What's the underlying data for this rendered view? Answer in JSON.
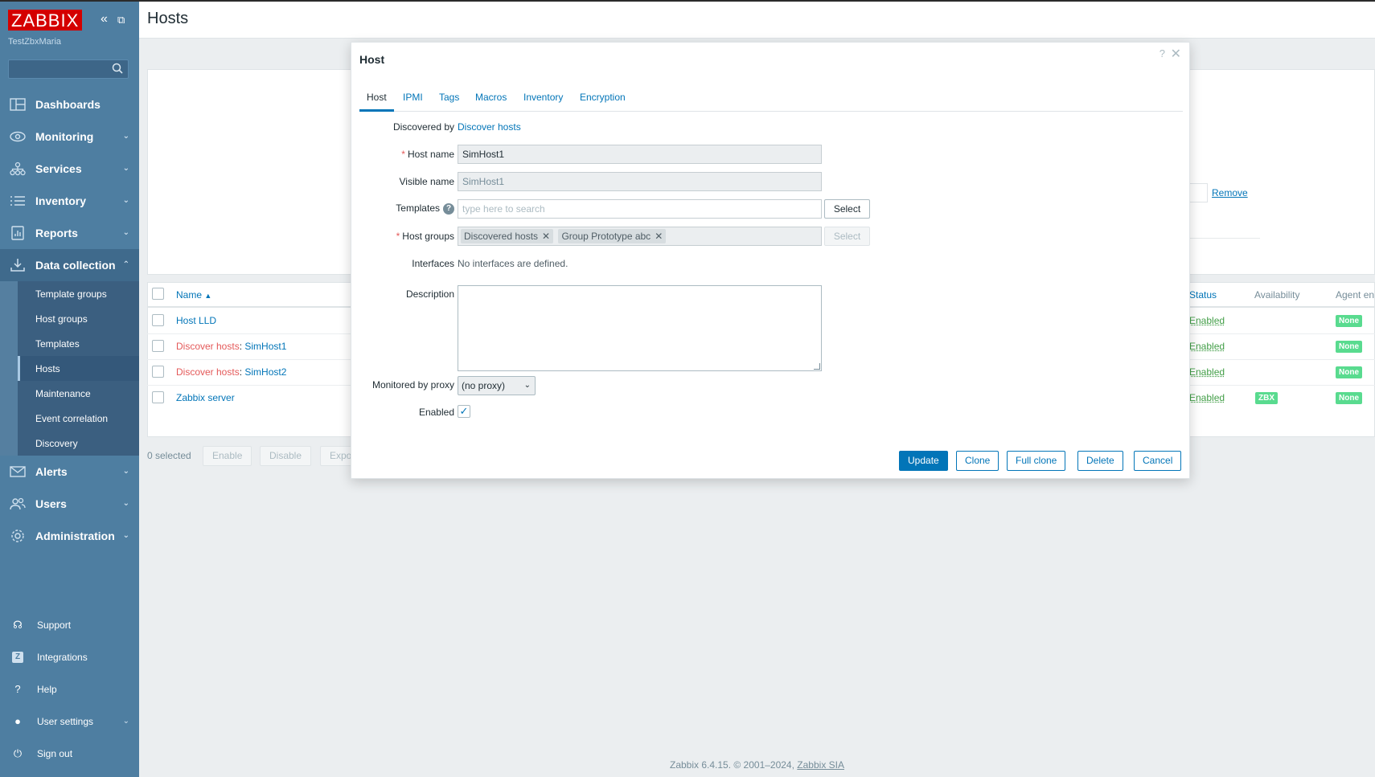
{
  "sidebar": {
    "logo": "ZABBIX",
    "org_name": "TestZbxMaria",
    "search_placeholder": "",
    "nav": [
      {
        "label": "Dashboards",
        "icon": "dashboards-icon"
      },
      {
        "label": "Monitoring",
        "icon": "eye-icon"
      },
      {
        "label": "Services",
        "icon": "services-icon"
      },
      {
        "label": "Inventory",
        "icon": "list-icon"
      },
      {
        "label": "Reports",
        "icon": "reports-icon"
      },
      {
        "label": "Data collection",
        "icon": "download-icon"
      }
    ],
    "submenu": [
      "Template groups",
      "Host groups",
      "Templates",
      "Hosts",
      "Maintenance",
      "Event correlation",
      "Discovery"
    ],
    "nav2": [
      {
        "label": "Alerts",
        "icon": "envelope-icon"
      },
      {
        "label": "Users",
        "icon": "users-icon"
      },
      {
        "label": "Administration",
        "icon": "gear-icon"
      }
    ],
    "bottom": [
      {
        "label": "Support",
        "icon": "headset-icon"
      },
      {
        "label": "Integrations",
        "icon": "integrations-icon"
      },
      {
        "label": "Help",
        "icon": "question-icon"
      },
      {
        "label": "User settings",
        "icon": "user-icon"
      },
      {
        "label": "Sign out",
        "icon": "power-icon"
      }
    ]
  },
  "page": {
    "title": "Hosts",
    "remove_link": "Remove",
    "table": {
      "columns": {
        "name": "Name",
        "status": "Status",
        "availability": "Availability",
        "agent_encryption": "Agent en"
      },
      "rows": [
        {
          "prefix": "",
          "name": "Host LLD",
          "status": "Enabled",
          "availability": "",
          "encryption": "None"
        },
        {
          "prefix": "Discover hosts",
          "name": "SimHost1",
          "status": "Enabled",
          "availability": "",
          "encryption": "None"
        },
        {
          "prefix": "Discover hosts",
          "name": "SimHost2",
          "status": "Enabled",
          "availability": "",
          "encryption": "None"
        },
        {
          "prefix": "",
          "name": "Zabbix server",
          "status": "Enabled",
          "availability": "ZBX",
          "encryption": "None"
        }
      ]
    },
    "selected_count": "0 selected",
    "mass_buttons": [
      "Enable",
      "Disable",
      "Expo"
    ],
    "footer": {
      "text": "Zabbix 6.4.15. © 2001–2024,",
      "link": "Zabbix SIA"
    }
  },
  "dialog": {
    "title": "Host",
    "tabs": [
      "Host",
      "IPMI",
      "Tags",
      "Macros",
      "Inventory",
      "Encryption"
    ],
    "active_tab": "Host",
    "discovered_by_label": "Discovered by",
    "discovered_by_value": "Discover hosts",
    "host_name_label": "Host name",
    "host_name_value": "SimHost1",
    "visible_name_label": "Visible name",
    "visible_name_value": "SimHost1",
    "templates_label": "Templates",
    "templates_placeholder": "type here to search",
    "select_label": "Select",
    "host_groups_label": "Host groups",
    "host_groups": [
      "Discovered hosts",
      "Group Prototype abc"
    ],
    "interfaces_label": "Interfaces",
    "interfaces_value": "No interfaces are defined.",
    "description_label": "Description",
    "description_value": "",
    "proxy_label": "Monitored by proxy",
    "proxy_value": "(no proxy)",
    "enabled_label": "Enabled",
    "enabled_checked": true,
    "buttons": {
      "update": "Update",
      "clone": "Clone",
      "full_clone": "Full clone",
      "delete": "Delete",
      "cancel": "Cancel"
    }
  },
  "colors": {
    "sidebar": "#4e7ea1",
    "link": "#0275b8",
    "lld_prefix": "#e45959",
    "enabled": "#429e47",
    "badge": "#59db8f",
    "logo": "#d40000"
  }
}
